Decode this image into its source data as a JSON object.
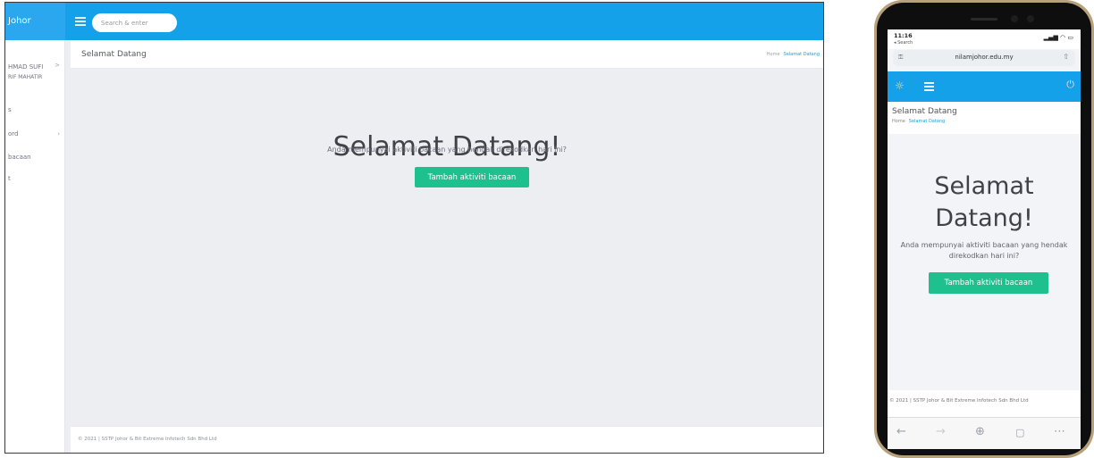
{
  "desktop": {
    "brand": "Johor",
    "search": {
      "placeholder": "Search & enter"
    },
    "sidebar": {
      "lines": [
        "HMAD SUFI",
        "RIF MAHATIR",
        "s",
        "ord",
        "bacaan",
        "t"
      ],
      "chevron": ">"
    },
    "page_title": "Selamat Datang",
    "breadcrumb": {
      "home": "Home",
      "current": "Selamat Datang"
    },
    "hero": {
      "title": "Selamat Datang!",
      "subtitle": "Anda mempunyai aktiviti bacaan yang hendak direkodkan hari ini?",
      "button": "Tambah aktiviti bacaan"
    },
    "footer": "© 2021 | SSTP Johor & Bit Extreme Infotech Sdn Bhd Ltd"
  },
  "mobile": {
    "status": {
      "time": "11:16",
      "back_label": "◂ Search",
      "icons": "▂▄▆ ◠ ▭"
    },
    "url": "nilamjohor.edu.my",
    "page_title": "Selamat Datang",
    "breadcrumb": {
      "home": "Home",
      "current": "Selamat Datang"
    },
    "hero": {
      "title_line1": "Selamat",
      "title_line2": "Datang!",
      "subtitle": "Anda mempunyai aktiviti bacaan yang hendak direkodkan hari ini?",
      "button": "Tambah aktiviti bacaan"
    },
    "footer": "© 2021 | SSTP Johor & Bit Extreme Infotech Sdn Bhd Ltd"
  },
  "colors": {
    "topbar": "#15a0ea",
    "accent_green": "#1ec08e",
    "background": "#eceef2",
    "phone_frame": "#b7a17a"
  },
  "icons": {
    "menu": "hamburger-icon",
    "sun": "sun-icon",
    "power": "power-icon",
    "share": "share-icon",
    "key": "key-icon",
    "back": "arrow-left-icon",
    "forward": "arrow-right-icon",
    "new_tab": "plus-icon",
    "tabs": "tabs-icon",
    "more": "more-icon"
  }
}
